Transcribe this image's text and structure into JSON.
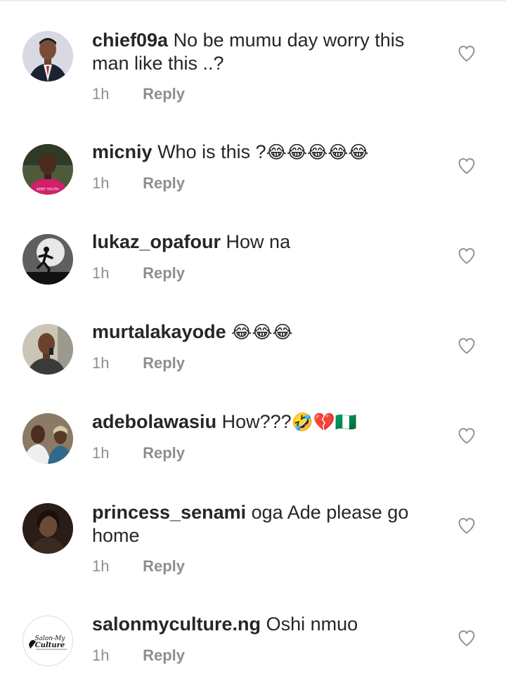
{
  "comments": [
    {
      "username": "chief09a",
      "text_line1": "No be mumu day worry this",
      "text_line2": "man like this ..?",
      "emoji": "",
      "time": "1h",
      "reply": "Reply"
    },
    {
      "username": "micniy",
      "text_line1": "Who is this ?",
      "emoji": "😂😂😂😂😂",
      "time": "1h",
      "reply": "Reply"
    },
    {
      "username": "lukaz_opafour",
      "text_line1": "How na",
      "emoji": "",
      "time": "1h",
      "reply": "Reply"
    },
    {
      "username": "murtalakayode",
      "text_line1": "",
      "emoji": "😂😂😂",
      "time": "1h",
      "reply": "Reply"
    },
    {
      "username": "adebolawasiu",
      "text_line1": "How???",
      "emoji": "🤣💔🇳🇬",
      "time": "1h",
      "reply": "Reply"
    },
    {
      "username": "princess_senami",
      "text_line1": "oga Ade please go",
      "text_line2": "home",
      "emoji": "",
      "time": "1h",
      "reply": "Reply"
    },
    {
      "username": "salonmyculture.ng",
      "text_line1": "Oshi nmuo",
      "emoji": "",
      "time": "1h",
      "reply": "Reply",
      "avatar_logo_line1": "Salon-My",
      "avatar_logo_line2": "Culture"
    }
  ],
  "icons": {
    "like": "heart-outline-icon"
  },
  "colors": {
    "text": "#262626",
    "meta": "#8e8e8e",
    "background": "#ffffff"
  }
}
